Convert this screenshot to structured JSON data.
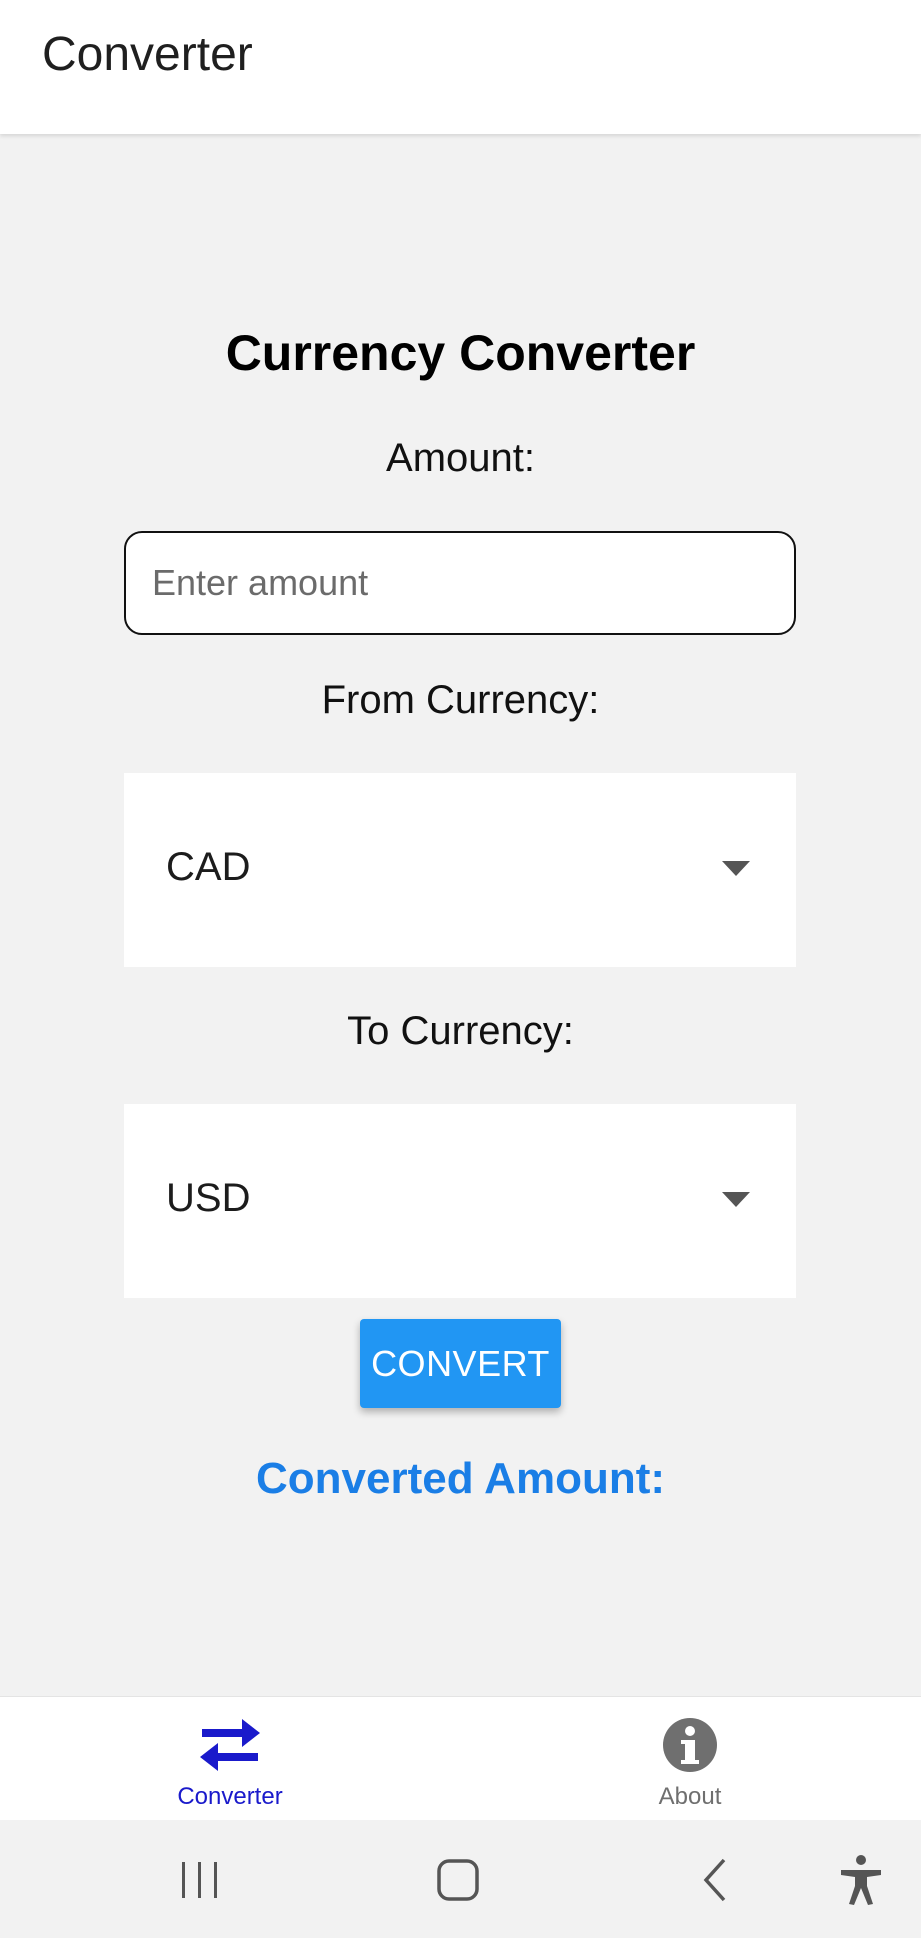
{
  "header": {
    "title": "Converter"
  },
  "main": {
    "heading": "Currency Converter",
    "amount_label": "Amount:",
    "amount_placeholder": "Enter amount",
    "amount_value": "",
    "from_label": "From Currency:",
    "from_value": "CAD",
    "to_label": "To Currency:",
    "to_value": "USD",
    "convert_label": "CONVERT",
    "result_label": "Converted Amount:"
  },
  "tabs": [
    {
      "label": "Converter",
      "icon": "swap-arrows-icon",
      "active": true
    },
    {
      "label": "About",
      "icon": "info-icon",
      "active": false
    }
  ],
  "system_nav": {
    "buttons": [
      "recent-apps-icon",
      "home-icon",
      "back-icon",
      "accessibility-icon"
    ]
  },
  "colors": {
    "accent": "#2196f3",
    "result_text": "#1a7ee6",
    "active_tab": "#1a1acb",
    "inactive_tab": "#6f6f6f",
    "background": "#f2f2f2"
  }
}
